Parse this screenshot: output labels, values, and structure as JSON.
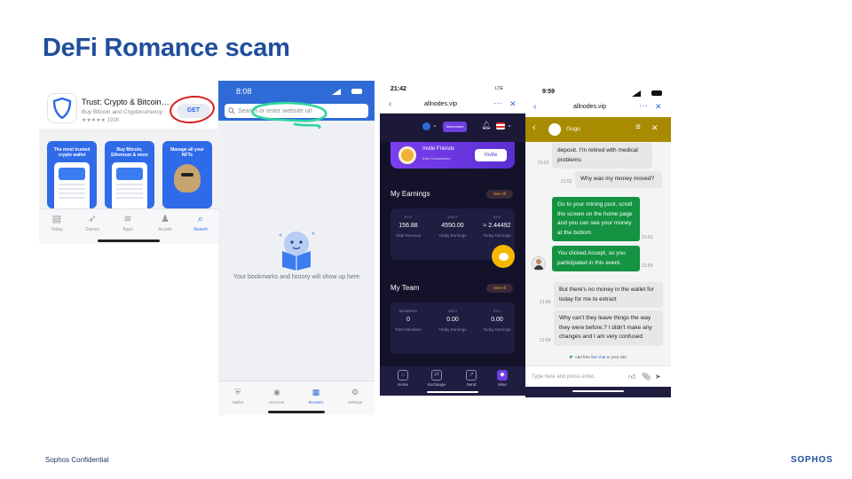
{
  "slide": {
    "title": "DeFi Romance scam",
    "footer_left": "Sophos Confidential",
    "footer_logo": "SOPHOS"
  },
  "app_store": {
    "app_name": "Trust: Crypto & Bitcoin…",
    "app_subtitle": "Buy Bitcoin and Cryptocurrency",
    "rating": "★★★★★ 193K",
    "get_label": "GET",
    "screenshots": [
      "The most trusted crypto wallet",
      "Buy Bitcoin, Ethereum & more",
      "Manage all your NFTs"
    ],
    "tabs": [
      {
        "label": "Today",
        "icon": "today-icon"
      },
      {
        "label": "Games",
        "icon": "rocket-icon"
      },
      {
        "label": "Apps",
        "icon": "layers-icon"
      },
      {
        "label": "Arcade",
        "icon": "joystick-icon"
      },
      {
        "label": "Search",
        "icon": "search-icon"
      }
    ]
  },
  "wallet_browser": {
    "time": "8:08",
    "search_placeholder": "Search or enter website url",
    "empty_text": "Your bookmarks and history will show up here",
    "tabs": [
      {
        "label": "Wallet",
        "icon": "shield-icon"
      },
      {
        "label": "Discover",
        "icon": "compass-icon"
      },
      {
        "label": "Browser",
        "icon": "grid-icon"
      },
      {
        "label": "Settings",
        "icon": "gear-icon"
      }
    ],
    "highlight_color": "#2fd6a0"
  },
  "allnodes": {
    "time": "21:42",
    "carrier": "LTE",
    "url": "allnodes.vip",
    "disconnect_label": "Disconnect",
    "invite_title": "Invite Friends",
    "invite_sub": "Earn Commission",
    "invite_button": "Invite",
    "earnings_title": "My Earnings",
    "team_title": "My Team",
    "see_all": "See All",
    "earnings": {
      "keys": [
        "ETH",
        "USDT",
        "ETH"
      ],
      "values": [
        "156.88",
        "4550.00",
        "≈ 2.44492"
      ],
      "captions": [
        "Total Revenue",
        "Today Earnings",
        "Today Earnings"
      ]
    },
    "team": {
      "keys": [
        "MEMBERS",
        "USDT",
        "ETH"
      ],
      "values": [
        "0",
        "0.00",
        "0.00"
      ],
      "captions": [
        "Total Members",
        "Today Earnings",
        "Today Earnings"
      ]
    },
    "nav": [
      "Home",
      "Exchange",
      "Send",
      "Mine"
    ],
    "accent": "#6b3fe0"
  },
  "chat": {
    "time": "9:59",
    "url": "allnodes.vip",
    "agent_name": "Gugu",
    "messages": [
      {
        "dir": "in",
        "text": "deposit. I'm retired with medical problems",
        "time": "21:52"
      },
      {
        "dir": "in",
        "text": "Why was my money moved?",
        "time": "21:52"
      },
      {
        "dir": "out",
        "text": "Go to your mining pool, scroll the screen on the home page and you can see your money at the bottom",
        "time": "21:53"
      },
      {
        "dir": "out",
        "text": "You clicked Accept, so you participated in this event.",
        "time": "21:54"
      },
      {
        "dir": "in",
        "text": "But there's no money in the wallet for today for me to extract",
        "time": "21:54"
      },
      {
        "dir": "in",
        "text": "Why can't they leave things the way they were before.? I didn't make any changes and I am very confused",
        "time": "21:54"
      }
    ],
    "livechat_link": "live chat",
    "livechat_pre": "Add free",
    "livechat_post": "to your site",
    "input_placeholder": "Type here and press enter..",
    "header_color": "#a88b00",
    "bubble_out_color": "#149342"
  }
}
